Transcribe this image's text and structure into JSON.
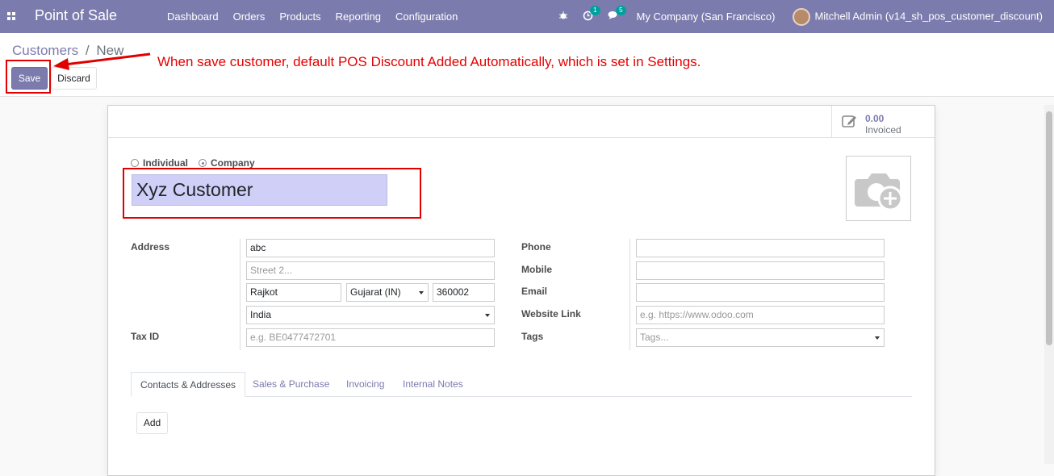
{
  "navbar": {
    "app_title": "Point of Sale",
    "menu": [
      "Dashboard",
      "Orders",
      "Products",
      "Reporting",
      "Configuration"
    ],
    "activity_badge": "1",
    "messages_badge": "5",
    "company": "My Company (San Francisco)",
    "user": "Mitchell Admin (v14_sh_pos_customer_discount)"
  },
  "control_panel": {
    "breadcrumb_parent": "Customers",
    "breadcrumb_separator": "/",
    "breadcrumb_current": "New",
    "save_label": "Save",
    "discard_label": "Discard"
  },
  "annotation": "When save customer, default POS Discount Added Automatically, which is set in Settings.",
  "stat_button": {
    "value": "0.00",
    "label": "Invoiced"
  },
  "company_type": {
    "individual": "Individual",
    "company": "Company",
    "selected": "Company"
  },
  "name": "Xyz Customer",
  "address": {
    "label": "Address",
    "street": "abc",
    "street2_placeholder": "Street 2...",
    "city": "Rajkot",
    "state": "Gujarat (IN)",
    "zip": "360002",
    "country": "India"
  },
  "tax_id": {
    "label": "Tax ID",
    "placeholder": "e.g. BE0477472701"
  },
  "contact": {
    "phone_label": "Phone",
    "mobile_label": "Mobile",
    "email_label": "Email",
    "website_label": "Website Link",
    "website_placeholder": "e.g. https://www.odoo.com",
    "tags_label": "Tags",
    "tags_placeholder": "Tags..."
  },
  "tabs": [
    "Contacts & Addresses",
    "Sales & Purchase",
    "Invoicing",
    "Internal Notes"
  ],
  "add_label": "Add",
  "colors": {
    "brand": "#7c7bad",
    "highlight": "#e00000",
    "name_bg": "#cfcff8"
  }
}
